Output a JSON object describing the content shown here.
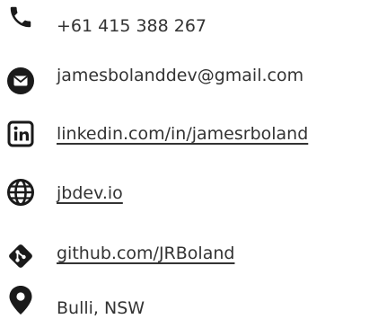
{
  "contacts": {
    "phone": {
      "icon": "phone-icon",
      "text": "+61 415 388 267"
    },
    "email": {
      "icon": "email-icon",
      "text": "jamesbolanddev@gmail.com"
    },
    "linkedin": {
      "icon": "linkedin-icon",
      "text": "linkedin.com/in/jamesrboland"
    },
    "website": {
      "icon": "globe-icon",
      "text": "jbdev.io"
    },
    "github": {
      "icon": "git-icon",
      "text": "github.com/JRBoland"
    },
    "location": {
      "icon": "map-pin-icon",
      "text": "Bulli, NSW"
    }
  },
  "colors": {
    "text": "#333333",
    "icon": "#1a1a1a"
  }
}
